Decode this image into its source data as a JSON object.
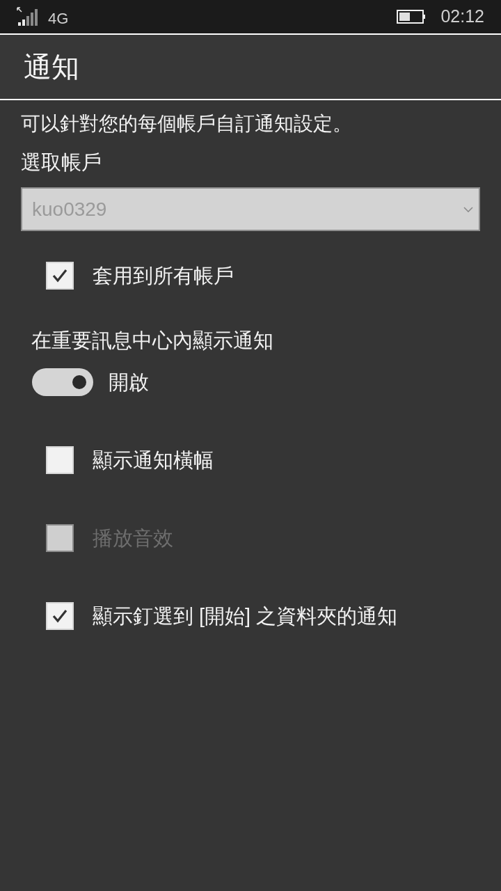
{
  "status_bar": {
    "network": "4G",
    "time": "02:12"
  },
  "header": {
    "title": "通知"
  },
  "description": "可以針對您的每個帳戶自訂通知設定。",
  "account_label": "選取帳戶",
  "account_dropdown": {
    "value": "kuo0329",
    "disabled": true
  },
  "apply_to_all": {
    "label": "套用到所有帳戶",
    "checked": true,
    "disabled": false
  },
  "action_center": {
    "heading": "在重要訊息中心內顯示通知",
    "on": true,
    "state_label": "開啟"
  },
  "options": [
    {
      "label": "顯示通知橫幅",
      "checked": false,
      "disabled": false
    },
    {
      "label": "播放音效",
      "checked": false,
      "disabled": true
    },
    {
      "label": "顯示釘選到 [開始] 之資料夾的通知",
      "checked": true,
      "disabled": false
    }
  ]
}
